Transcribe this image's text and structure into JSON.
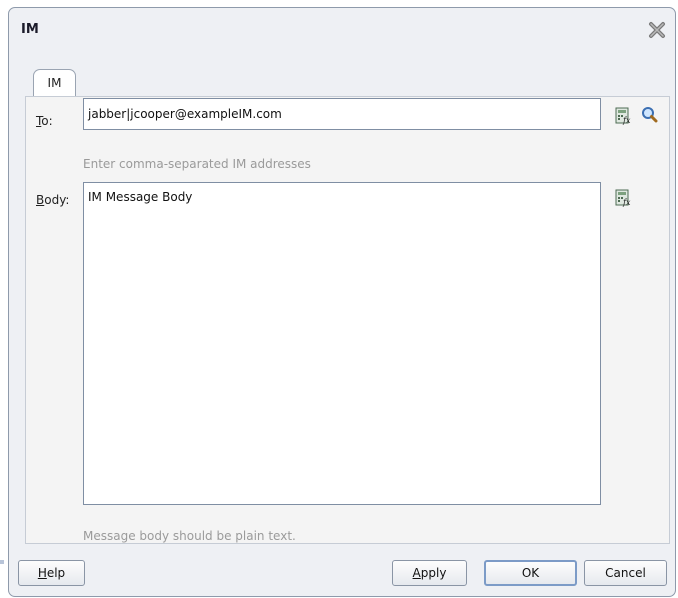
{
  "dialog": {
    "title": "IM",
    "close_icon": "close-x-icon"
  },
  "tabs": [
    {
      "label": "IM",
      "selected": true
    }
  ],
  "form": {
    "to_label_prefix": "",
    "to_label_mnemonic": "T",
    "to_label_rest": "o:",
    "to_value": "jabber|jcooper@exampleIM.com",
    "to_hint": "Enter comma-separated IM addresses",
    "body_label_mnemonic": "B",
    "body_label_rest": "ody:",
    "body_value": "IM Message Body",
    "body_hint": "Message body should be plain text.",
    "icons": [
      "expression-builder-icon",
      "search-icon"
    ]
  },
  "buttons": {
    "help_mnemonic": "H",
    "help_rest": "elp",
    "apply_mnemonic": "A",
    "apply_rest": "pply",
    "ok": "OK",
    "cancel": "Cancel"
  }
}
